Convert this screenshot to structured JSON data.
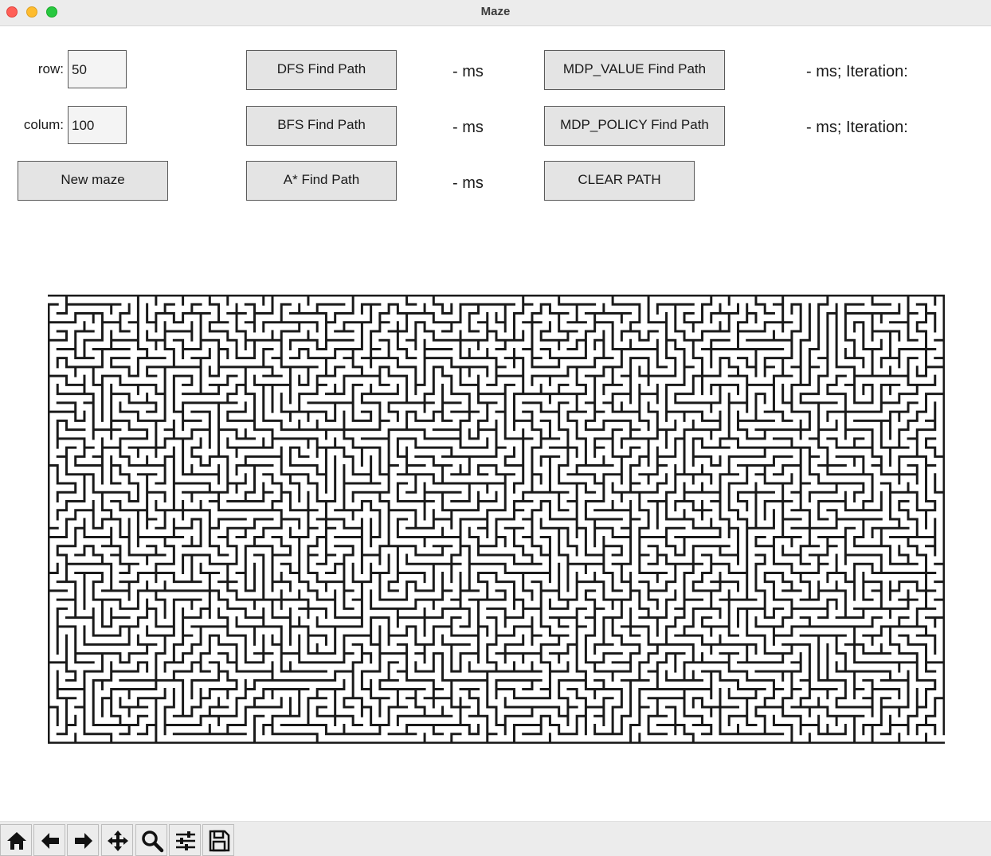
{
  "window": {
    "title": "Maze"
  },
  "controls": {
    "row_label": "row:",
    "row_value": "50",
    "column_label": "colum:",
    "column_value": "100",
    "new_maze_label": "New maze"
  },
  "solvers": {
    "dfs_label": "DFS Find Path",
    "dfs_time": "- ms",
    "bfs_label": "BFS Find Path",
    "bfs_time": "- ms",
    "astar_label": "A* Find Path",
    "astar_time": "- ms",
    "mdp_value_label": "MDP_VALUE Find Path",
    "mdp_value_stat": "- ms; Iteration:",
    "mdp_policy_label": "MDP_POLICY Find Path",
    "mdp_policy_stat": "- ms; Iteration:",
    "clear_label": "CLEAR PATH"
  },
  "maze": {
    "rows": 50,
    "columns": 100,
    "wall_color": "#1a1a1a"
  },
  "toolbar": {
    "icons": [
      "home-icon",
      "back-arrow-icon",
      "forward-arrow-icon",
      "pan-icon",
      "zoom-icon",
      "configure-icon",
      "save-icon"
    ]
  }
}
